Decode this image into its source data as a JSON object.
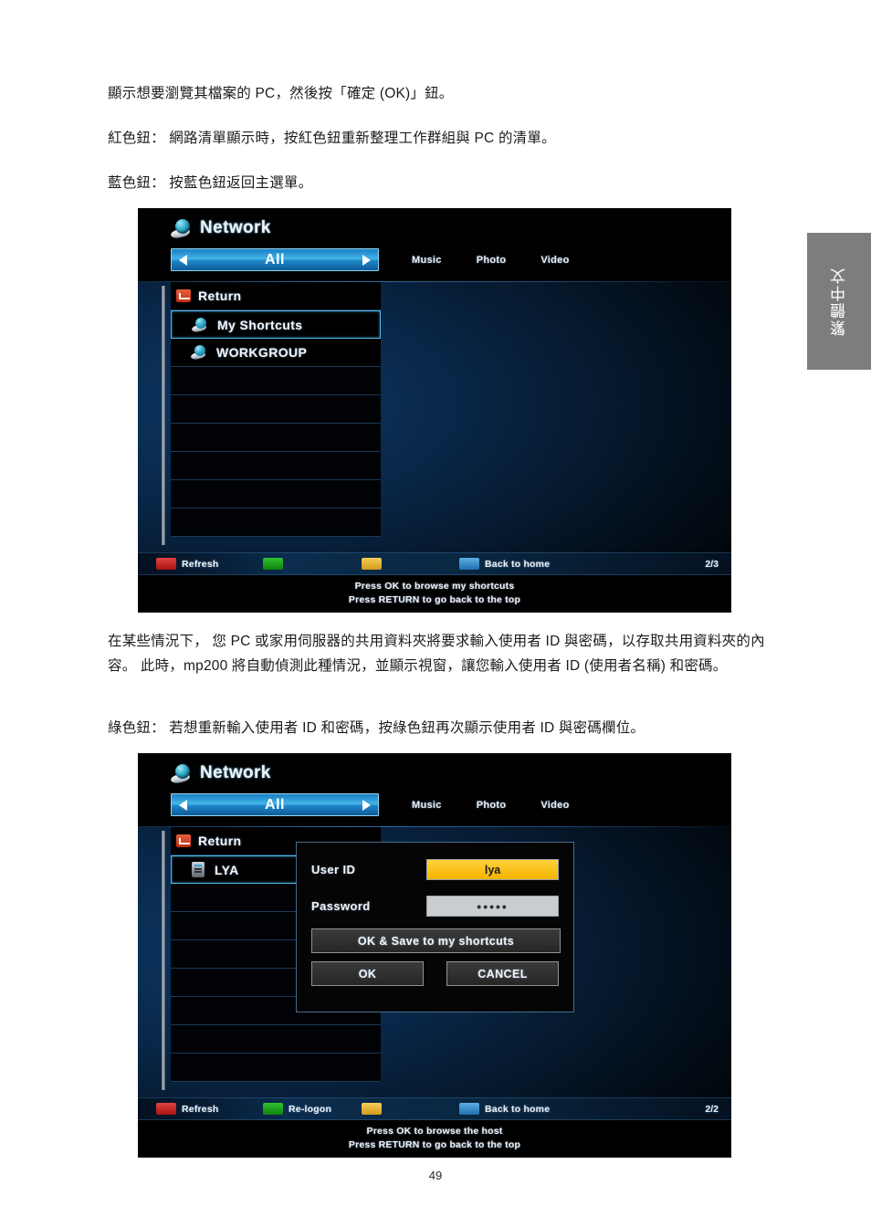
{
  "document": {
    "paragraphs": {
      "p1": "顯示想要瀏覽其檔案的 PC，然後按「確定 (OK)」鈕。",
      "p2": "紅色鈕： 網路清單顯示時，按紅色鈕重新整理工作群組與 PC 的清單。",
      "p3": "藍色鈕： 按藍色鈕返回主選單。",
      "p4": "在某些情況下， 您 PC 或家用伺服器的共用資料夾將要求輸入使用者 ID 與密碼，以存取共用資料夾的內容。 此時，mp200 將自動偵測此種情況，並顯示視窗，讓您輸入使用者 ID (使用者名稱) 和密碼。",
      "p5": "綠色鈕： 若想重新輸入使用者 ID 和密碼，按綠色鈕再次顯示使用者 ID 與密碼欄位。"
    },
    "page_number": "49",
    "language_tab": "繁體中文"
  },
  "screenshot1": {
    "title": "Network",
    "selector": {
      "value": "All",
      "left_arrow": "left-arrow-icon",
      "right_arrow": "right-arrow-icon"
    },
    "tabs": [
      "Music",
      "Photo",
      "Video"
    ],
    "list": [
      {
        "label": "Return",
        "icon": "return-icon",
        "selected": false,
        "indent": false
      },
      {
        "label": "My Shortcuts",
        "icon": "globe-icon",
        "selected": true,
        "indent": true
      },
      {
        "label": "WORKGROUP",
        "icon": "globe-icon",
        "selected": false,
        "indent": true
      }
    ],
    "empty_rows": 6,
    "color_keys": [
      {
        "color": "#cc2222",
        "label": "Refresh"
      },
      {
        "color": "#19a219",
        "label": ""
      },
      {
        "color": "#e8b832",
        "label": ""
      },
      {
        "color": "#3a8fd0",
        "label": "Back to home"
      }
    ],
    "page_indicator": "2/3",
    "hints": [
      "Press OK to browse my shortcuts",
      "Press RETURN to go back to the top"
    ]
  },
  "screenshot2": {
    "title": "Network",
    "selector": {
      "value": "All",
      "left_arrow": "left-arrow-icon",
      "right_arrow": "right-arrow-icon"
    },
    "tabs": [
      "Music",
      "Photo",
      "Video"
    ],
    "list": [
      {
        "label": "Return",
        "icon": "return-icon",
        "selected": false,
        "indent": false
      },
      {
        "label": "LYA",
        "icon": "pc-icon",
        "selected": true,
        "indent": true
      }
    ],
    "empty_rows": 7,
    "dialog": {
      "user_id_label": "User ID",
      "user_id_value": "lya",
      "password_label": "Password",
      "password_value": "•••••",
      "save_button": "OK & Save to my shortcuts",
      "ok_button": "OK",
      "cancel_button": "CANCEL"
    },
    "color_keys": [
      {
        "color": "#cc2222",
        "label": "Refresh"
      },
      {
        "color": "#19a219",
        "label": "Re-logon"
      },
      {
        "color": "#e8b832",
        "label": ""
      },
      {
        "color": "#3a8fd0",
        "label": "Back to home"
      }
    ],
    "page_indicator": "2/2",
    "hints": [
      "Press OK to browse the host",
      "Press RETURN to go back to the top"
    ]
  }
}
